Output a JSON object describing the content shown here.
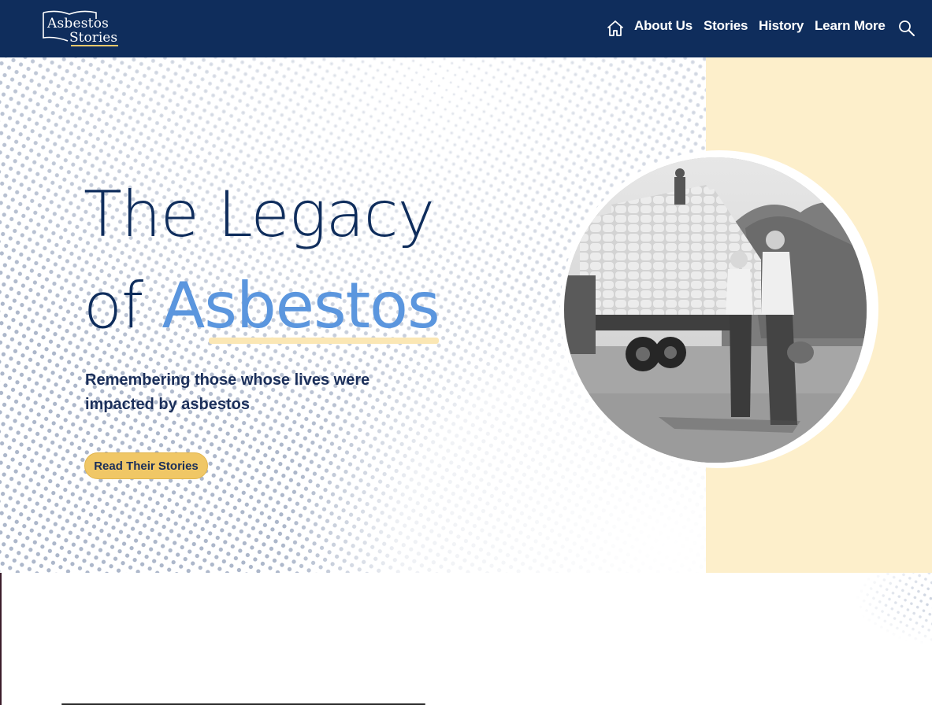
{
  "brand": {
    "logo_line1": "Asbestos",
    "logo_line2": "Stories"
  },
  "nav": {
    "home_icon": "home-icon",
    "items": [
      {
        "label": "About Us"
      },
      {
        "label": "Stories"
      },
      {
        "label": "History"
      },
      {
        "label": "Learn More"
      }
    ],
    "search_icon": "search-icon"
  },
  "hero": {
    "title_line1": "The Legacy",
    "title_of": "of ",
    "title_accent": "Asbestos",
    "subtitle": "Remembering those whose lives were impacted by asbestos",
    "cta_label": "Read Their Stories",
    "photo_icon": "historical-photo-trucks-and-men"
  },
  "colors": {
    "header_bg": "#0f2d5c",
    "accent_blue": "#5b96de",
    "cream": "#fdefcb",
    "cta_gold": "#f0c766",
    "text_navy": "#0f2d5c"
  }
}
